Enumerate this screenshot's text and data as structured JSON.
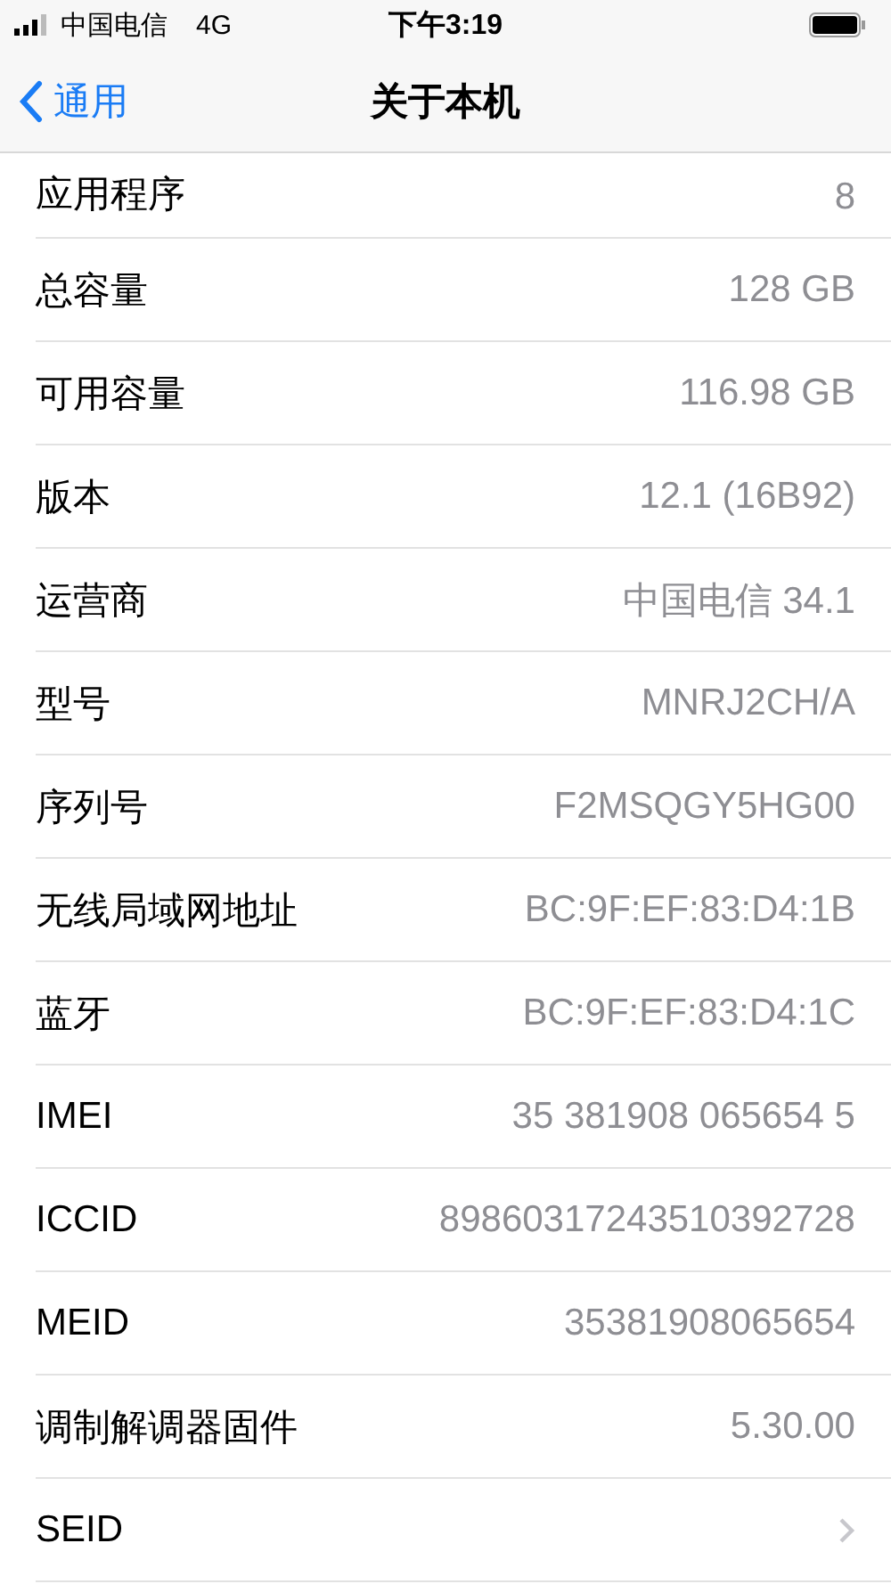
{
  "status_bar": {
    "carrier": "中国电信",
    "network": "4G",
    "time": "下午3:19"
  },
  "nav": {
    "back": "通用",
    "title": "关于本机"
  },
  "rows": [
    {
      "kind": "value",
      "label": "应用程序",
      "value": "8"
    },
    {
      "kind": "value",
      "label": "总容量",
      "value": "128 GB"
    },
    {
      "kind": "value",
      "label": "可用容量",
      "value": "116.98 GB"
    },
    {
      "kind": "value",
      "label": "版本",
      "value": "12.1 (16B92)"
    },
    {
      "kind": "value",
      "label": "运营商",
      "value": "中国电信 34.1"
    },
    {
      "kind": "value",
      "label": "型号",
      "value": "MNRJ2CH/A"
    },
    {
      "kind": "value",
      "label": "序列号",
      "value": "F2MSQGY5HG00"
    },
    {
      "kind": "value",
      "label": "无线局域网地址",
      "value": "BC:9F:EF:83:D4:1B"
    },
    {
      "kind": "value",
      "label": "蓝牙",
      "value": "BC:9F:EF:83:D4:1C"
    },
    {
      "kind": "value",
      "label": "IMEI",
      "value": "35 381908 065654 5"
    },
    {
      "kind": "value",
      "label": "ICCID",
      "value": "89860317243510392728"
    },
    {
      "kind": "value",
      "label": "MEID",
      "value": "35381908065654"
    },
    {
      "kind": "value",
      "label": "调制解调器固件",
      "value": "5.30.00"
    },
    {
      "kind": "link",
      "label": "SEID"
    }
  ]
}
